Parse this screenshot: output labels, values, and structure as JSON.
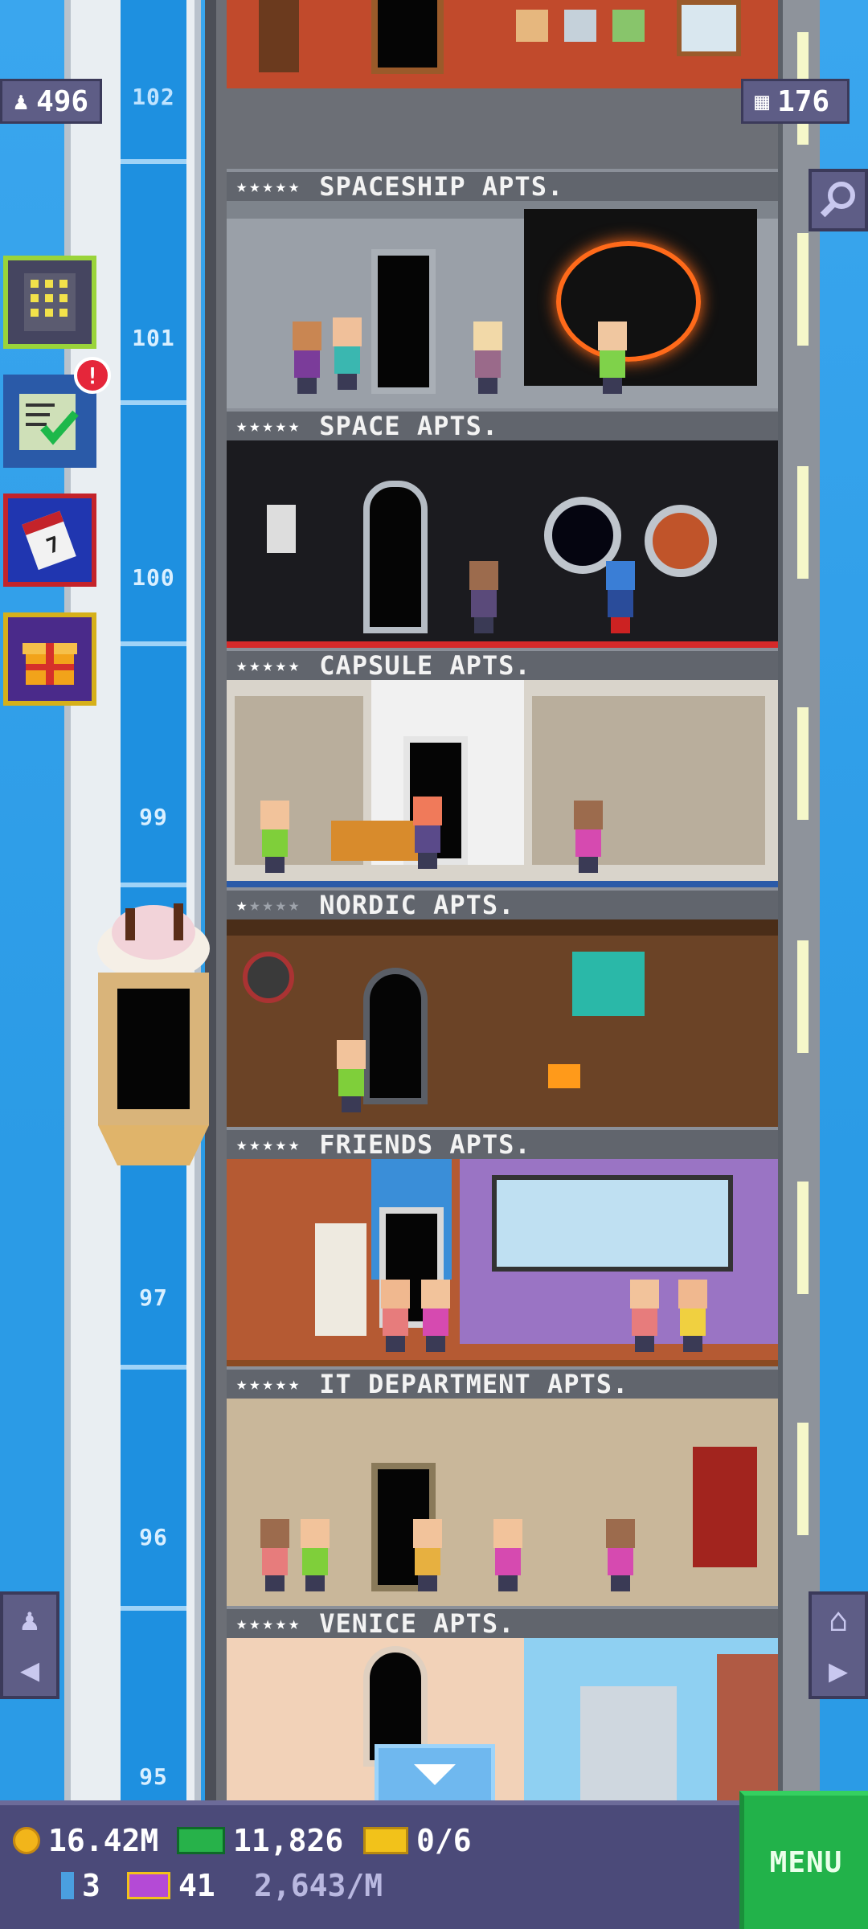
{
  "colors": {
    "sky": "#2ea0e8",
    "bar": "#4b4a79",
    "menu": "#22b24a",
    "badge": "#e5263a"
  },
  "top_stats": {
    "population": "496",
    "floors": "176"
  },
  "shaft_labels": [
    "102",
    "101",
    "100",
    "99",
    "97",
    "96",
    "95"
  ],
  "floors": [
    {
      "name": "SPACESHIP APTS.",
      "stars": 5
    },
    {
      "name": "SPACE APTS.",
      "stars": 5
    },
    {
      "name": "CAPSULE APTS.",
      "stars": 5
    },
    {
      "name": "NORDIC APTS.",
      "stars": 1
    },
    {
      "name": "FRIENDS APTS.",
      "stars": 5
    },
    {
      "name": "IT DEPARTMENT APTS.",
      "stars": 5
    },
    {
      "name": "VENICE APTS.",
      "stars": 5
    }
  ],
  "side_buttons": [
    {
      "icon": "building-icon"
    },
    {
      "icon": "checklist-icon",
      "badge": "!"
    },
    {
      "icon": "calendar-icon",
      "text": "7"
    },
    {
      "icon": "gift-icon"
    }
  ],
  "bottom": {
    "coins": "16.42M",
    "bux": "11,826",
    "tickets": "0/6",
    "keys": "3",
    "vip": "41",
    "income": "2,643/M",
    "menu": "MENU"
  }
}
